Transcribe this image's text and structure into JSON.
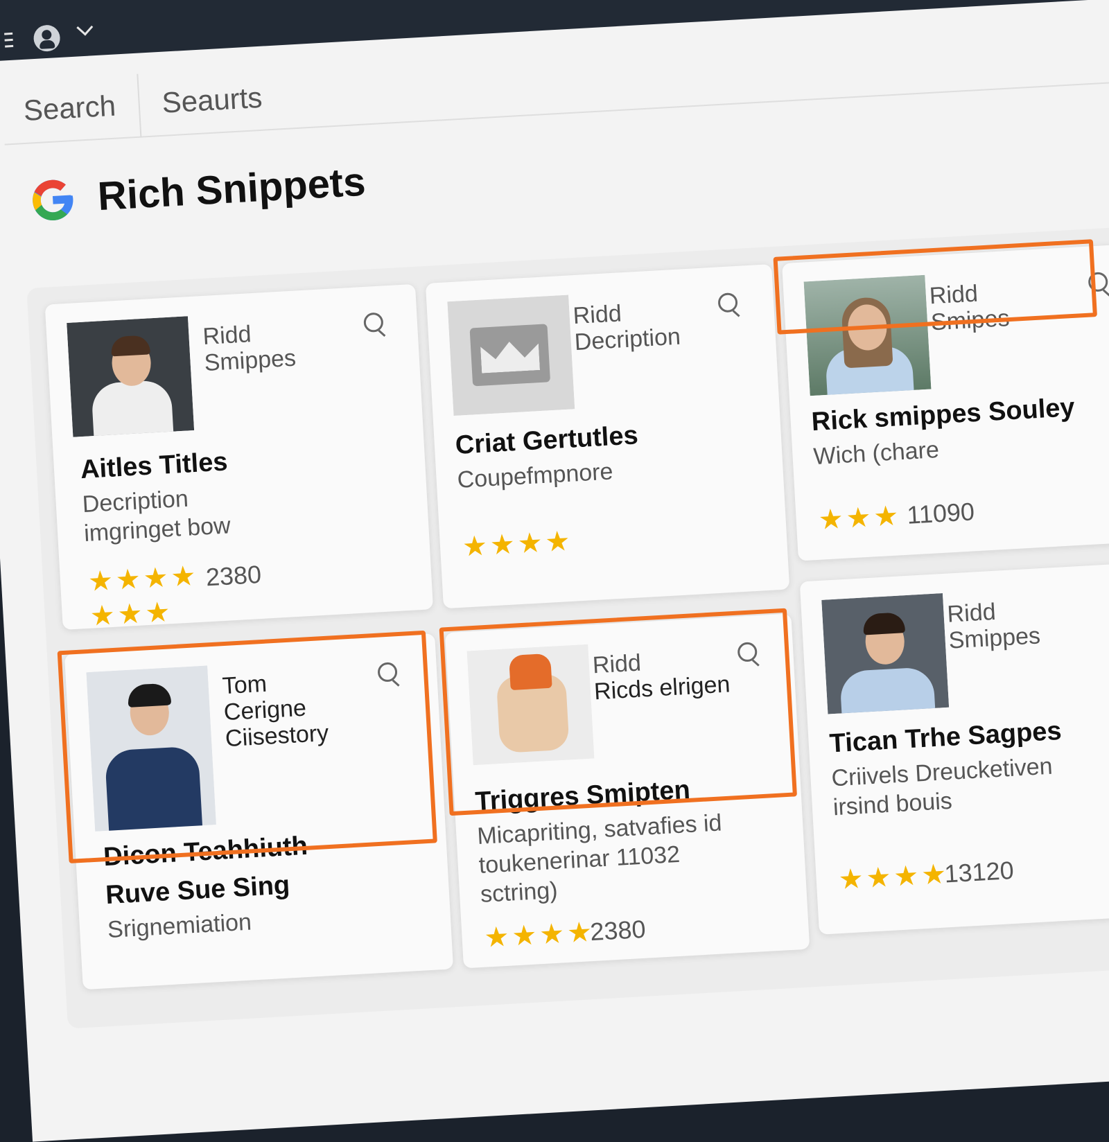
{
  "tabs": [
    {
      "label": "Search"
    },
    {
      "label": "Seaurts"
    }
  ],
  "header": {
    "title": "Rich Snippets"
  },
  "cards": [
    {
      "small_line1": "Ridd",
      "small_line2": "Smippes",
      "title": "Aitles Titles",
      "desc_line1": "Decription",
      "desc_line2": "imgringet bow",
      "rating_stars": "★★★★",
      "rating_stars2": "★★★",
      "count": "2380"
    },
    {
      "small_line1": "Ridd",
      "small_line2": "Decription",
      "title": "Criat Gertutles",
      "desc_line1": "Coupefmpnore",
      "rating_stars": "★★★★"
    },
    {
      "small_line1": "Ridd",
      "small_line2": "Smipes",
      "title": "Rick smippes Souley",
      "desc_line1": "Wich (chare",
      "rating_stars": "★★★",
      "count": "11090"
    },
    {
      "small_line1": "Tom",
      "small_line2": "Cerigne",
      "small_line3": "Ciisestory",
      "title": "Dicon Teahhiuth",
      "title2": "Ruve Sue Sing",
      "desc_line1": "Srignemiation"
    },
    {
      "small_line1": "Ridd",
      "small_line2": "Ricds elrigen",
      "title": "Triggres Smipten",
      "desc_line1": "Micapriting, satvafies id",
      "desc_line2": "toukenerinar 11032",
      "desc_line3": "sctring)",
      "rating_stars": "★★★★",
      "count": "2380"
    },
    {
      "small_line1": "Ridd",
      "small_line2": "Smippes",
      "title": "Tican Trhe Sagpes",
      "desc_line1": "Criivels Dreucketiven",
      "desc_line2": "irsind bouis",
      "rating_stars": "★★★★",
      "count": "13120"
    }
  ],
  "colors": {
    "accent_highlight": "#f07020",
    "star": "#f4b400",
    "topbar": "#222a35"
  }
}
